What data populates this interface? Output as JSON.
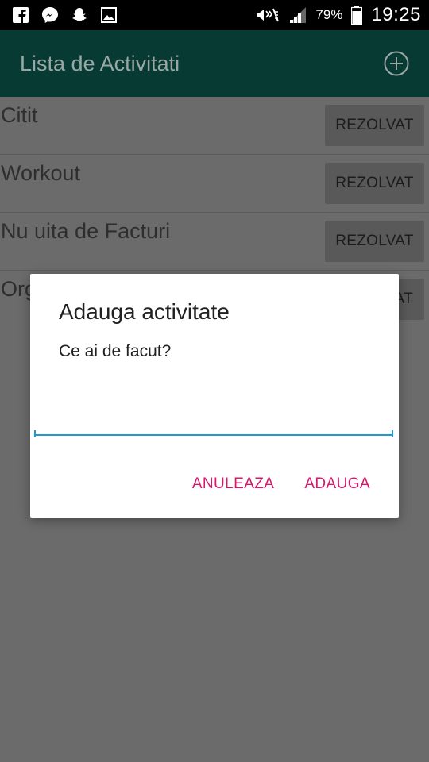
{
  "status_bar": {
    "notification_icons": [
      "facebook-icon",
      "messenger-icon",
      "snapchat-icon",
      "gallery-icon"
    ],
    "system_icons": [
      "mute-icon",
      "signal-icon",
      "battery-icon"
    ],
    "battery_percent": "79%",
    "time": "19:25"
  },
  "app_bar": {
    "title": "Lista de Activitati",
    "add_icon": "add-circle-icon",
    "color": "#063a33"
  },
  "list": {
    "items": [
      {
        "label": "Citit",
        "button": "REZOLVAT"
      },
      {
        "label": "Workout",
        "button": "REZOLVAT"
      },
      {
        "label": "Nu uita de Facturi",
        "button": "REZOLVAT"
      },
      {
        "label": "Org",
        "button": "AT"
      }
    ]
  },
  "dialog": {
    "title": "Adauga activitate",
    "message": "Ce ai de facut?",
    "input_value": "",
    "cancel_label": "ANULEAZA",
    "confirm_label": "ADAUGA",
    "accent_color": "#d6176b",
    "input_underline_color": "#1e9bd6"
  }
}
